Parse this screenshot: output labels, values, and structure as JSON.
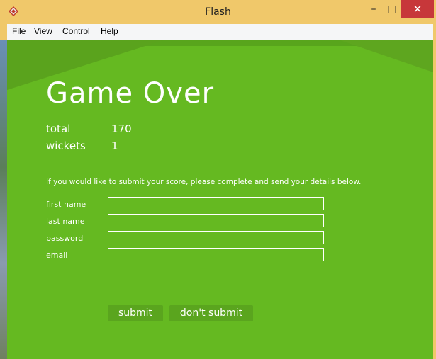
{
  "window": {
    "title": "Flash",
    "minimize_glyph": "–",
    "maximize_glyph": "□",
    "close_glyph": "✕"
  },
  "menu": {
    "items": [
      "File",
      "View",
      "Control",
      "Help"
    ]
  },
  "game": {
    "title": "Game Over",
    "stats": [
      {
        "label": "total",
        "value": "170"
      },
      {
        "label": "wickets",
        "value": "1"
      }
    ],
    "prompt": "If you would like to submit your score, please complete and send your details below.",
    "fields": [
      {
        "label": "first name",
        "value": ""
      },
      {
        "label": "last name",
        "value": ""
      },
      {
        "label": "password",
        "value": ""
      },
      {
        "label": "email",
        "value": ""
      }
    ],
    "submit_label": "submit",
    "dont_submit_label": "don't submit"
  },
  "colors": {
    "stage_green": "#65b921",
    "titlebar": "#f0c86a",
    "close_red": "#c7373a"
  },
  "icons": {
    "app": "flash-player-icon"
  }
}
